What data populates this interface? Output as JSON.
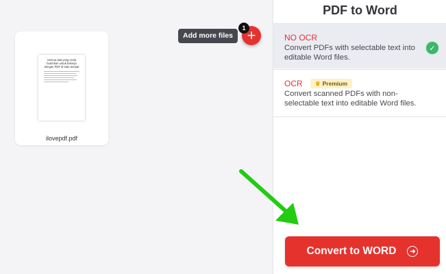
{
  "workspace": {
    "file": {
      "name": "ilovepdf.pdf",
      "thumbnail_text": "Semua alat yang Anda butuhkan untuk bekerja dengan PDF di satu tempat"
    },
    "add_files": {
      "tooltip": "Add more files",
      "count": "1",
      "icon": "plus-icon"
    }
  },
  "sidebar": {
    "title": "PDF to Word",
    "options": [
      {
        "title": "NO OCR",
        "description": "Convert PDFs with selectable text into editable Word files.",
        "selected": true
      },
      {
        "title": "OCR",
        "badge": "Premium",
        "description": "Convert scanned PDFs with non-selectable text into editable Word files.",
        "selected": false
      }
    ],
    "convert_button": "Convert to WORD"
  },
  "colors": {
    "accent": "#e5322d",
    "check": "#3cb56b",
    "annotation_arrow": "#22cc11"
  }
}
